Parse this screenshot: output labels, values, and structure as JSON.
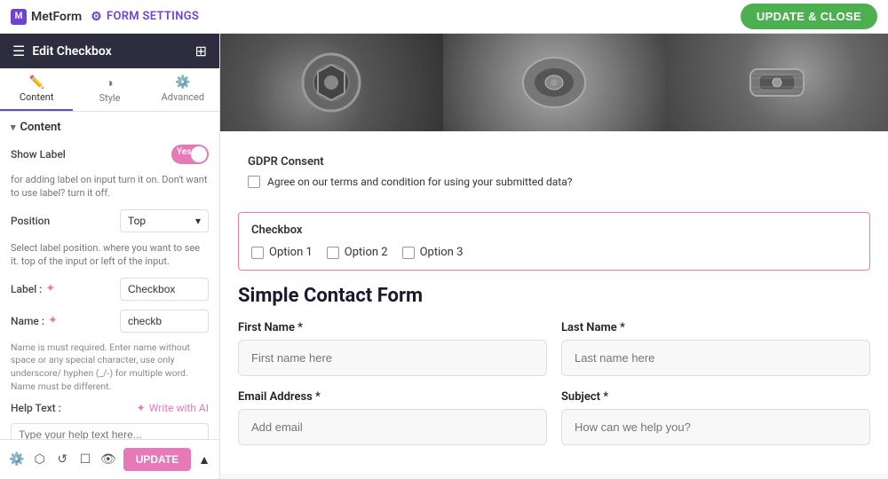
{
  "topbar": {
    "logo_text": "MetForm",
    "form_settings_label": "FORM SETTINGS",
    "update_close_label": "UPDATE & CLOSE"
  },
  "sidebar": {
    "header_title": "Edit Checkbox",
    "tabs": [
      {
        "id": "content",
        "label": "Content",
        "icon": "✏️"
      },
      {
        "id": "style",
        "label": "Style",
        "icon": "◑"
      },
      {
        "id": "advanced",
        "label": "Advanced",
        "icon": "⚙️"
      }
    ],
    "active_tab": "content",
    "section_title": "Content",
    "show_label": {
      "label": "Show Label",
      "value": "Yes",
      "hint": "for adding label on input turn it on. Don't want to use label? turn it off."
    },
    "position": {
      "label": "Position",
      "value": "Top",
      "hint": "Select label position. where you want to see it. top of the input or left of the input."
    },
    "label_field": {
      "label": "Label :",
      "value": "Checkbox"
    },
    "name_field": {
      "label": "Name :",
      "value": "checkb",
      "hint": "Name is must required. Enter name without space or any special character, use only underscore/ hyphen (_/-) for multiple word. Name must be different."
    },
    "help_text": {
      "label": "Help Text :",
      "write_with_ai": "Write with AI",
      "placeholder": "Type your help text here..."
    },
    "bottom_tools": [
      "⚙️",
      "⬡",
      "↺",
      "☐",
      "👁"
    ],
    "update_label": "UPDATE"
  },
  "preview": {
    "gdpr": {
      "title": "GDPR Consent",
      "text": "Agree on our terms and condition for using your submitted data?"
    },
    "checkbox_section": {
      "title": "Checkbox",
      "options": [
        "Option 1",
        "Option 2",
        "Option 3"
      ]
    },
    "contact_form": {
      "title": "Simple Contact Form",
      "fields": [
        {
          "label": "First Name *",
          "placeholder": "First name here",
          "col": "left"
        },
        {
          "label": "Last Name *",
          "placeholder": "Last name here",
          "col": "right"
        },
        {
          "label": "Email Address *",
          "placeholder": "Add email",
          "col": "left"
        },
        {
          "label": "Subject *",
          "placeholder": "How can we help you?",
          "col": "right"
        }
      ]
    }
  }
}
